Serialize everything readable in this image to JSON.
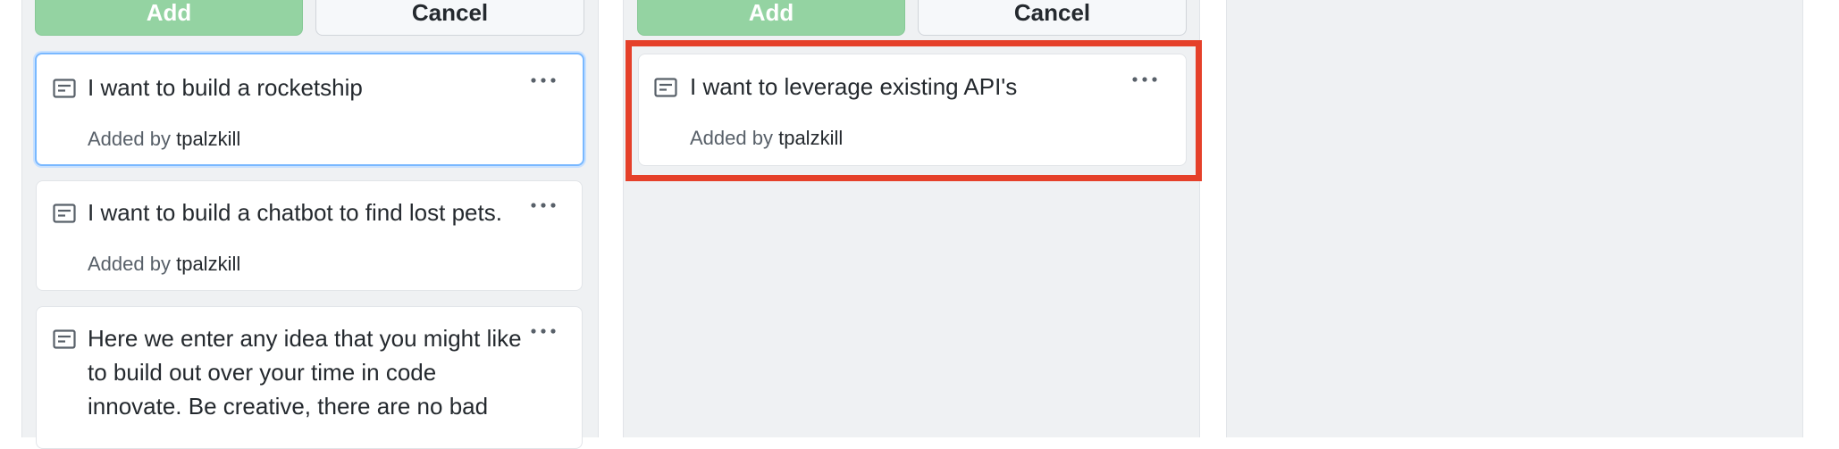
{
  "columns": [
    {
      "buttons": {
        "add_label": "Add",
        "cancel_label": "Cancel"
      },
      "cards": [
        {
          "title": "I want to build a rocketship",
          "meta_prefix": "Added by",
          "author": "tpalzkill"
        },
        {
          "title": "I want to build a chatbot to find lost pets.",
          "meta_prefix": "Added by",
          "author": "tpalzkill"
        },
        {
          "title_lines": [
            "Here we enter any idea that you might like",
            "to build out over your time in code",
            "innovate. Be creative, there are no bad"
          ]
        }
      ]
    },
    {
      "buttons": {
        "add_label": "Add",
        "cancel_label": "Cancel"
      },
      "cards": [
        {
          "title": "I want to leverage existing API's",
          "meta_prefix": "Added by",
          "author": "tpalzkill"
        }
      ]
    },
    {
      "cards": []
    }
  ],
  "colors": {
    "add_button_bg": "#94d3a2",
    "selected_card_border": "#79b8ff",
    "highlight_border": "#e5402a",
    "column_bg": "#eff1f3"
  },
  "icons": {
    "note": "note-icon",
    "menu": "kebab-horizontal-icon"
  }
}
